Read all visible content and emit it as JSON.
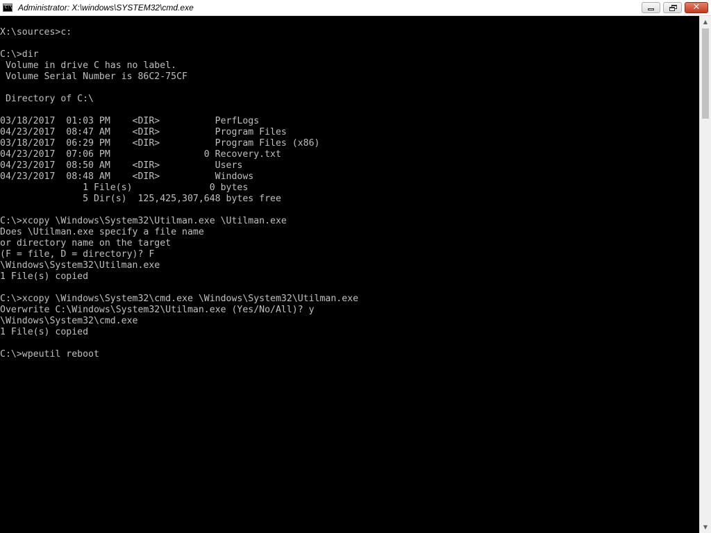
{
  "window": {
    "title": "Administrator: X:\\windows\\SYSTEM32\\cmd.exe",
    "icon": "console-app-icon",
    "icon_glyph": "C:\\",
    "close_glyph": "✕",
    "scroll_up_glyph": "▲",
    "scroll_down_glyph": "▼"
  },
  "console": {
    "background": "#000000",
    "foreground": "#c0c0c0",
    "lines": [
      "X:\\sources>c:",
      "",
      "C:\\>dir",
      " Volume in drive C has no label.",
      " Volume Serial Number is 86C2-75CF",
      "",
      " Directory of C:\\",
      "",
      "03/18/2017  01:03 PM    <DIR>          PerfLogs",
      "04/23/2017  08:47 AM    <DIR>          Program Files",
      "03/18/2017  06:29 PM    <DIR>          Program Files (x86)",
      "04/23/2017  07:06 PM                 0 Recovery.txt",
      "04/23/2017  08:50 AM    <DIR>          Users",
      "04/23/2017  08:48 AM    <DIR>          Windows",
      "               1 File(s)              0 bytes",
      "               5 Dir(s)  125,425,307,648 bytes free",
      "",
      "C:\\>xcopy \\Windows\\System32\\Utilman.exe \\Utilman.exe",
      "Does \\Utilman.exe specify a file name",
      "or directory name on the target",
      "(F = file, D = directory)? F",
      "\\Windows\\System32\\Utilman.exe",
      "1 File(s) copied",
      "",
      "C:\\>xcopy \\Windows\\System32\\cmd.exe \\Windows\\System32\\Utilman.exe",
      "Overwrite C:\\Windows\\System32\\Utilman.exe (Yes/No/All)? y",
      "\\Windows\\System32\\cmd.exe",
      "1 File(s) copied",
      "",
      "C:\\>wpeutil reboot"
    ]
  }
}
